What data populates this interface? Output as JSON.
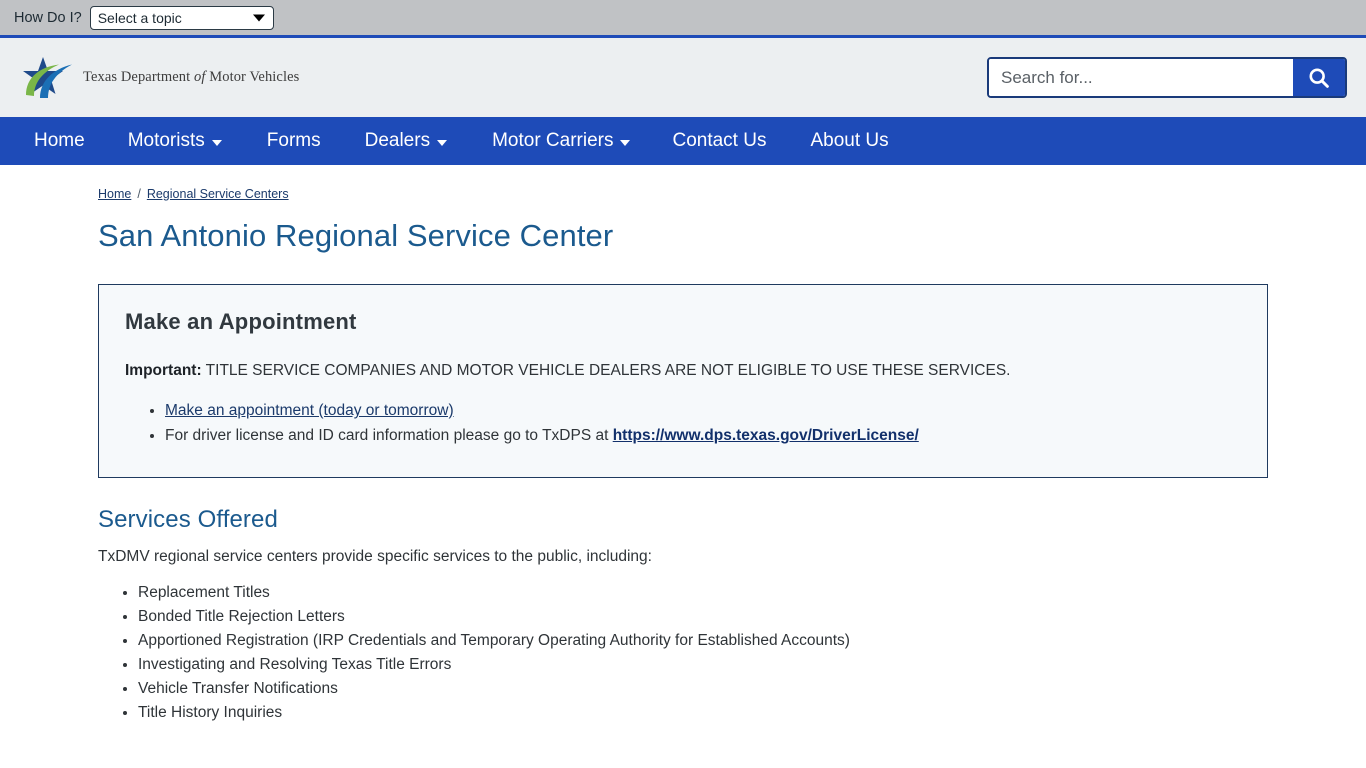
{
  "topbar": {
    "label": "How Do I?",
    "select_value": "Select a topic",
    "caret_icon": "chevron-down-icon"
  },
  "header": {
    "brand_line1": "Texas Department",
    "brand_italic": "of",
    "brand_line2": "Motor Vehicles",
    "search_placeholder": "Search for...",
    "search_value": "",
    "search_icon": "search-icon"
  },
  "nav": {
    "items": [
      {
        "label": "Home",
        "has_caret": false
      },
      {
        "label": "Motorists",
        "has_caret": true
      },
      {
        "label": "Forms",
        "has_caret": false
      },
      {
        "label": "Dealers",
        "has_caret": true
      },
      {
        "label": "Motor Carriers",
        "has_caret": true
      },
      {
        "label": "Contact Us",
        "has_caret": false
      },
      {
        "label": "About Us",
        "has_caret": false
      }
    ]
  },
  "breadcrumb": {
    "home": "Home",
    "separator": "/",
    "current": "Regional Service Centers"
  },
  "page": {
    "title": "San Antonio Regional Service Center"
  },
  "appointment_panel": {
    "title": "Make an Appointment",
    "important_label": "Important:",
    "important_text": " TITLE SERVICE COMPANIES AND MOTOR VEHICLE DEALERS ARE NOT ELIGIBLE TO USE THESE SERVICES.",
    "link_appointment": "Make an appointment (today or tomorrow)",
    "dps_text": "For driver license and ID card information please go to TxDPS at ",
    "dps_link": "https://www.dps.texas.gov/DriverLicense/"
  },
  "services": {
    "title": "Services Offered",
    "intro": "TxDMV regional service centers provide specific services to the public, including:",
    "items": [
      "Replacement Titles",
      "Bonded Title Rejection Letters",
      "Apportioned Registration (IRP Credentials and Temporary Operating Authority for Established Accounts)",
      "Investigating and Resolving Texas Title Errors",
      "Vehicle Transfer Notifications",
      "Title History Inquiries"
    ]
  },
  "colors": {
    "nav_blue": "#1e4bb8",
    "topbar_gray": "#c0c2c5",
    "header_gray": "#eceff1",
    "heading_blue": "#1b5a8e",
    "link_navy": "#1b3a6b",
    "panel_bg": "#f6f9fb",
    "logo_navy": "#1f4a8a",
    "logo_green": "#7ab648",
    "logo_blue": "#1b6fb5"
  }
}
